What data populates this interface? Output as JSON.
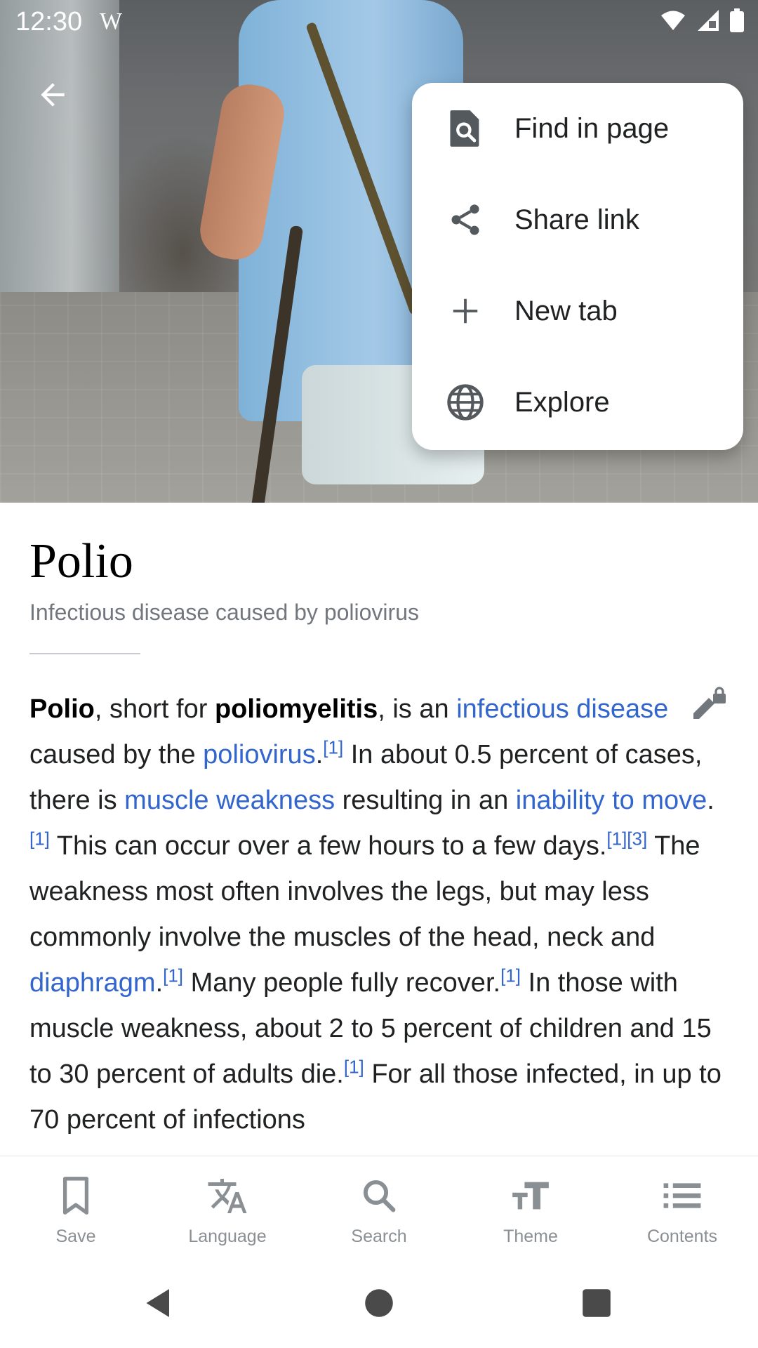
{
  "status_bar": {
    "time": "12:30",
    "app_glyph": "W"
  },
  "header": {
    "back_icon": "arrow-left-icon"
  },
  "menu": {
    "items": [
      {
        "label": "Find in page",
        "icon": "find-in-page-icon"
      },
      {
        "label": "Share link",
        "icon": "share-icon"
      },
      {
        "label": "New tab",
        "icon": "plus-icon"
      },
      {
        "label": "Explore",
        "icon": "globe-icon"
      }
    ]
  },
  "article": {
    "title": "Polio",
    "subtitle": "Infectious disease caused by poliovirus",
    "paragraph": {
      "t1": "Polio",
      "t2": ", short for ",
      "t3": "poliomyelitis",
      "t4": ", is an ",
      "l1": "infectious disease",
      "t5": " caused by the ",
      "l2": "poliovirus",
      "t6": ".",
      "r1": "[1]",
      "t7": " In about 0.5 percent of cases, there is ",
      "l3": "muscle weakness",
      "t8": " resulting in an ",
      "l4": "inability to move",
      "t9": ".",
      "r2": "[1]",
      "t10": " This can occur over a few hours to a few days.",
      "r3": "[1][3]",
      "t11": " The weakness most often involves the legs, but may less commonly involve the muscles of the head, neck and ",
      "l5": "diaphragm",
      "t12": ".",
      "r4": "[1]",
      "t13": " Many people fully recover.",
      "r5": "[1]",
      "t14": " In those with muscle weakness, about 2 to 5 percent of children and 15 to 30 percent of adults die.",
      "r6": "[1]",
      "t15": " For all those infected, in up to 70 percent of infections"
    }
  },
  "toolbar": {
    "items": [
      {
        "label": "Save",
        "icon": "bookmark-icon"
      },
      {
        "label": "Language",
        "icon": "translate-icon"
      },
      {
        "label": "Search",
        "icon": "search-icon"
      },
      {
        "label": "Theme",
        "icon": "text-size-icon"
      },
      {
        "label": "Contents",
        "icon": "list-icon"
      }
    ]
  },
  "colors": {
    "link": "#3366cc",
    "muted": "#8a8f94",
    "text": "#202122"
  }
}
